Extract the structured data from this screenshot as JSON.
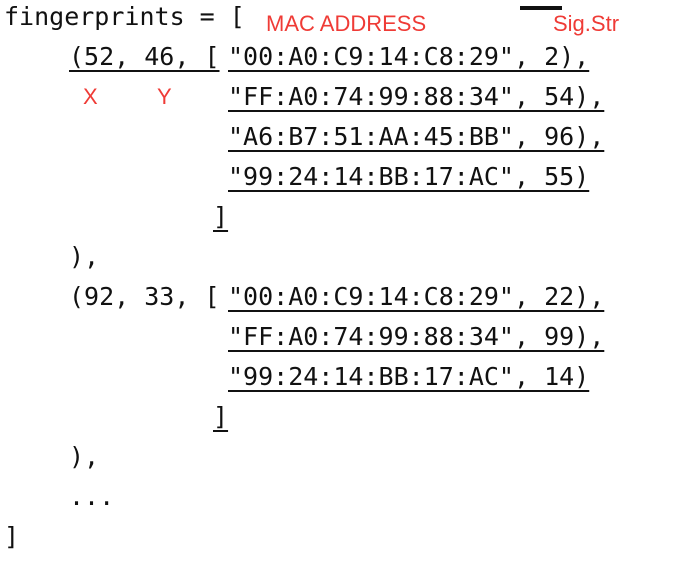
{
  "code": {
    "line1": "fingerprints = [",
    "fp1_open": "(52, 46, [",
    "fp1_entries": [
      "\"00:A0:C9:14:C8:29\", 2),",
      "\"FF:A0:74:99:88:34\", 54),",
      "\"A6:B7:51:AA:45:BB\", 96),",
      "\"99:24:14:BB:17:AC\", 55)"
    ],
    "fp1_list_close": "]",
    "fp1_close": "),",
    "fp2_open": "(92, 33, [",
    "fp2_entries": [
      "\"00:A0:C9:14:C8:29\", 22),",
      "\"FF:A0:74:99:88:34\", 99),",
      "\"99:24:14:BB:17:AC\", 14)"
    ],
    "fp2_list_close": "]",
    "fp2_close": "),",
    "ellipsis": "...",
    "end": "]"
  },
  "annotations": {
    "mac_address": "MAC ADDRESS",
    "sig_str": "Sig.Str",
    "x": "X",
    "y": "Y",
    "color": "#ef3b36"
  }
}
